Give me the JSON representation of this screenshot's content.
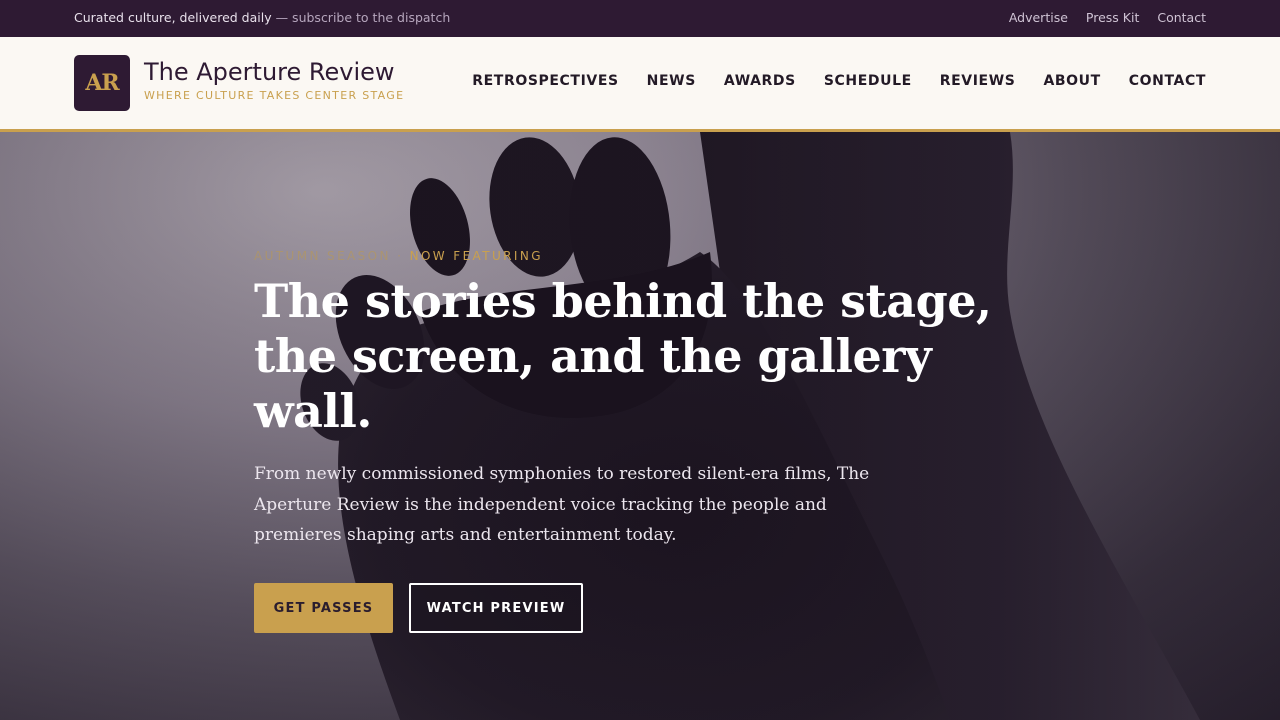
{
  "topbar": {
    "tagline": "Curated culture, delivered daily",
    "tagline_suffix": " — subscribe to the dispatch",
    "links": [
      "Advertise",
      "Press Kit",
      "Contact"
    ]
  },
  "brand": {
    "badge": "AR",
    "name": "The Aperture Review",
    "tagline": "WHERE CULTURE TAKES CENTER STAGE"
  },
  "nav": [
    "RETROSPECTIVES",
    "NEWS",
    "AWARDS",
    "SCHEDULE",
    "REVIEWS",
    "ABOUT",
    "CONTACT"
  ],
  "hero": {
    "eyebrow_a": "AUTUMN SEASON",
    "eyebrow_sep": " · ",
    "eyebrow_b": "NOW FEATURING",
    "headline": "The stories behind the stage, the screen, and the gallery wall.",
    "lede": "From newly commissioned symphonies to restored silent-era films, The Aperture Review is the independent voice tracking the people and premieres shaping arts and entertainment today.",
    "primary_cta": "GET PASSES",
    "secondary_cta": "WATCH PREVIEW",
    "background_image": "silhouette-foot-icon"
  },
  "colors": {
    "accent": "#c9a04e",
    "brand_dark": "#2e1a33",
    "header_bg": "#fbf8f3"
  }
}
